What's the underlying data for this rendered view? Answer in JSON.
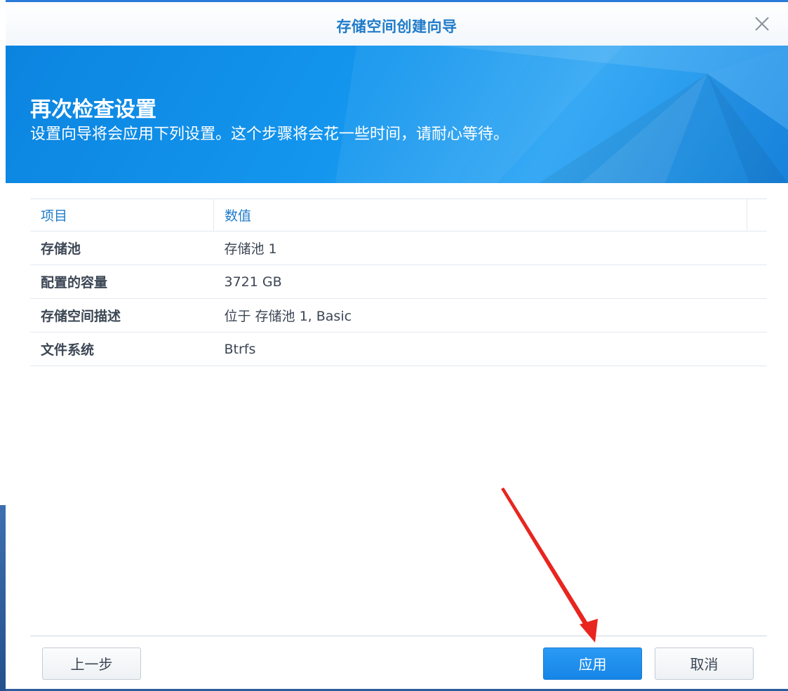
{
  "window": {
    "title": "存储空间创建向导"
  },
  "banner": {
    "heading": "再次检查设置",
    "subheading": "设置向导将会应用下列设置。这个步骤将会花一些时间，请耐心等待。"
  },
  "table": {
    "headers": [
      "项目",
      "数值"
    ],
    "rows": [
      {
        "key": "存储池",
        "value": "存储池 1"
      },
      {
        "key": "配置的容量",
        "value": "3721 GB"
      },
      {
        "key": "存储空间描述",
        "value": "位于 存储池 1, Basic"
      },
      {
        "key": "文件系统",
        "value": "Btrfs"
      }
    ]
  },
  "footer": {
    "back_label": "上一步",
    "apply_label": "应用",
    "cancel_label": "取消"
  },
  "colors": {
    "accent": "#1f7bc9",
    "banner": "#1496ee",
    "primary_button": "#1685e6",
    "annotation_arrow": "#e8251f"
  },
  "icons": {
    "close": "close-icon",
    "annotation": "red-arrow-icon"
  }
}
